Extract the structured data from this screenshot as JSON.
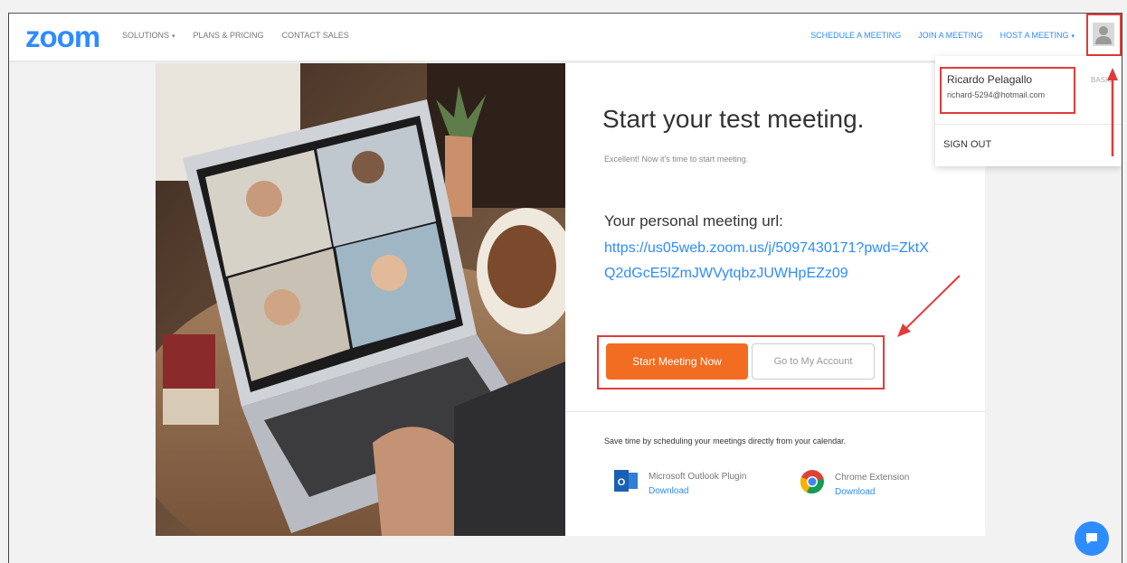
{
  "navbar": {
    "logo": "zoom",
    "left_links": [
      "SOLUTIONS",
      "PLANS & PRICING",
      "CONTACT SALES"
    ],
    "right_links": [
      "SCHEDULE A MEETING",
      "JOIN A MEETING",
      "HOST A MEETING"
    ],
    "caret": "▾"
  },
  "panel": {
    "title": "Start your test meeting.",
    "subtitle": "Excellent! Now it's time to start meeting.",
    "url_label": "Your personal meeting url:",
    "url": "https://us05web.zoom.us/j/5097430171?pwd=ZktXQ2dGcE5lZmJWVytqbzJUWHpEZz09",
    "start_button": "Start Meeting Now",
    "account_button": "Go to My Account",
    "save_time": "Save time by scheduling your meetings directly from your calendar.",
    "plugins": [
      {
        "name": "Microsoft Outlook Plugin",
        "download": "Download",
        "icon": "outlook-icon"
      },
      {
        "name": "Chrome Extension",
        "download": "Download",
        "icon": "chrome-icon"
      }
    ]
  },
  "dropdown": {
    "name": "Ricardo Pelagallo",
    "email": "richard-5294@hotmail.com",
    "plan": "BASIC",
    "sign_out": "SIGN OUT"
  },
  "colors": {
    "brand": "#2d8cff",
    "orange": "#f26d21",
    "highlight": "#e23a3a"
  }
}
